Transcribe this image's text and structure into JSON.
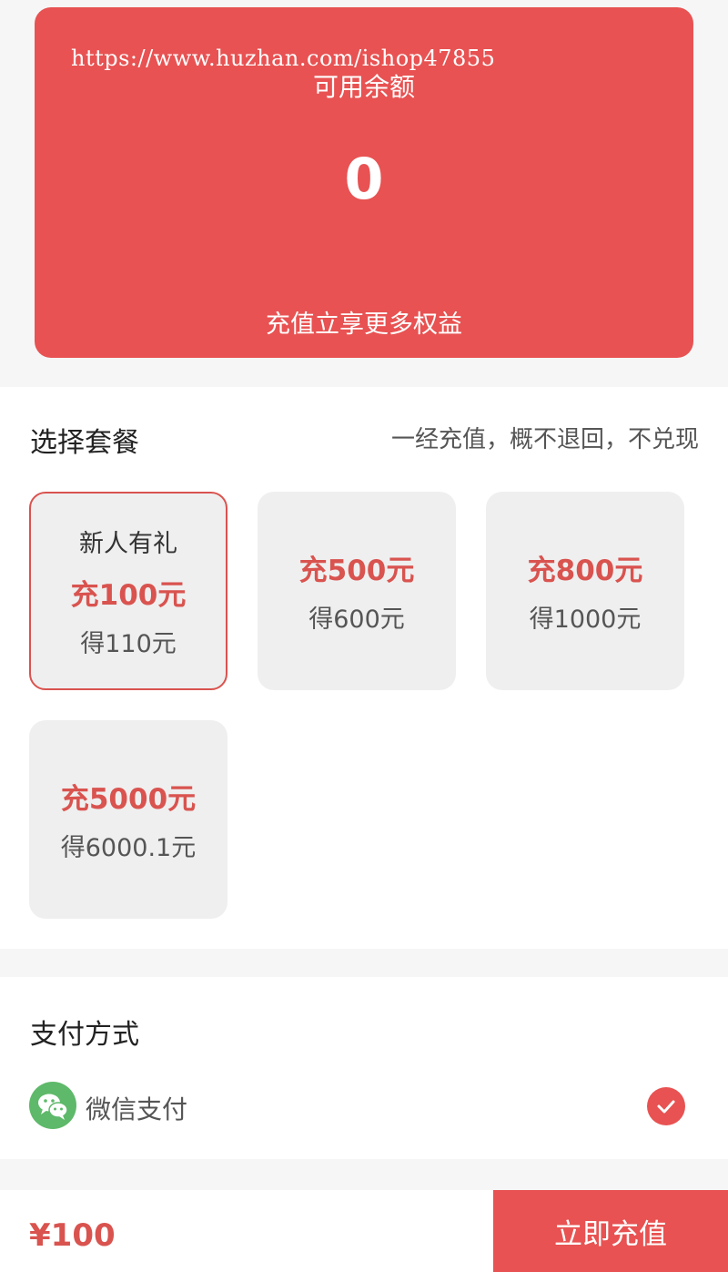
{
  "watermark": "https://www.huzhan.com/ishop47855",
  "balance": {
    "label": "可用余额",
    "value": "0",
    "subtitle": "充值立享更多权益"
  },
  "packages": {
    "title": "选择套餐",
    "notice": "一经充值，概不退回，不兑现",
    "items": [
      {
        "tag": "新人有礼",
        "charge": "充100元",
        "get": "得110元",
        "selected": true
      },
      {
        "tag": "",
        "charge": "充500元",
        "get": "得600元",
        "selected": false
      },
      {
        "tag": "",
        "charge": "充800元",
        "get": "得1000元",
        "selected": false
      },
      {
        "tag": "",
        "charge": "充5000元",
        "get": "得6000.1元",
        "selected": false
      }
    ]
  },
  "payment": {
    "title": "支付方式",
    "method": "微信支付",
    "icon": "wechat-icon",
    "selected_icon": "check-icon"
  },
  "footer": {
    "price": "¥100",
    "submit_label": "立即充值"
  },
  "colors": {
    "accent": "#e85252",
    "accent_text": "#d9534f",
    "wechat": "#5eb96a"
  }
}
